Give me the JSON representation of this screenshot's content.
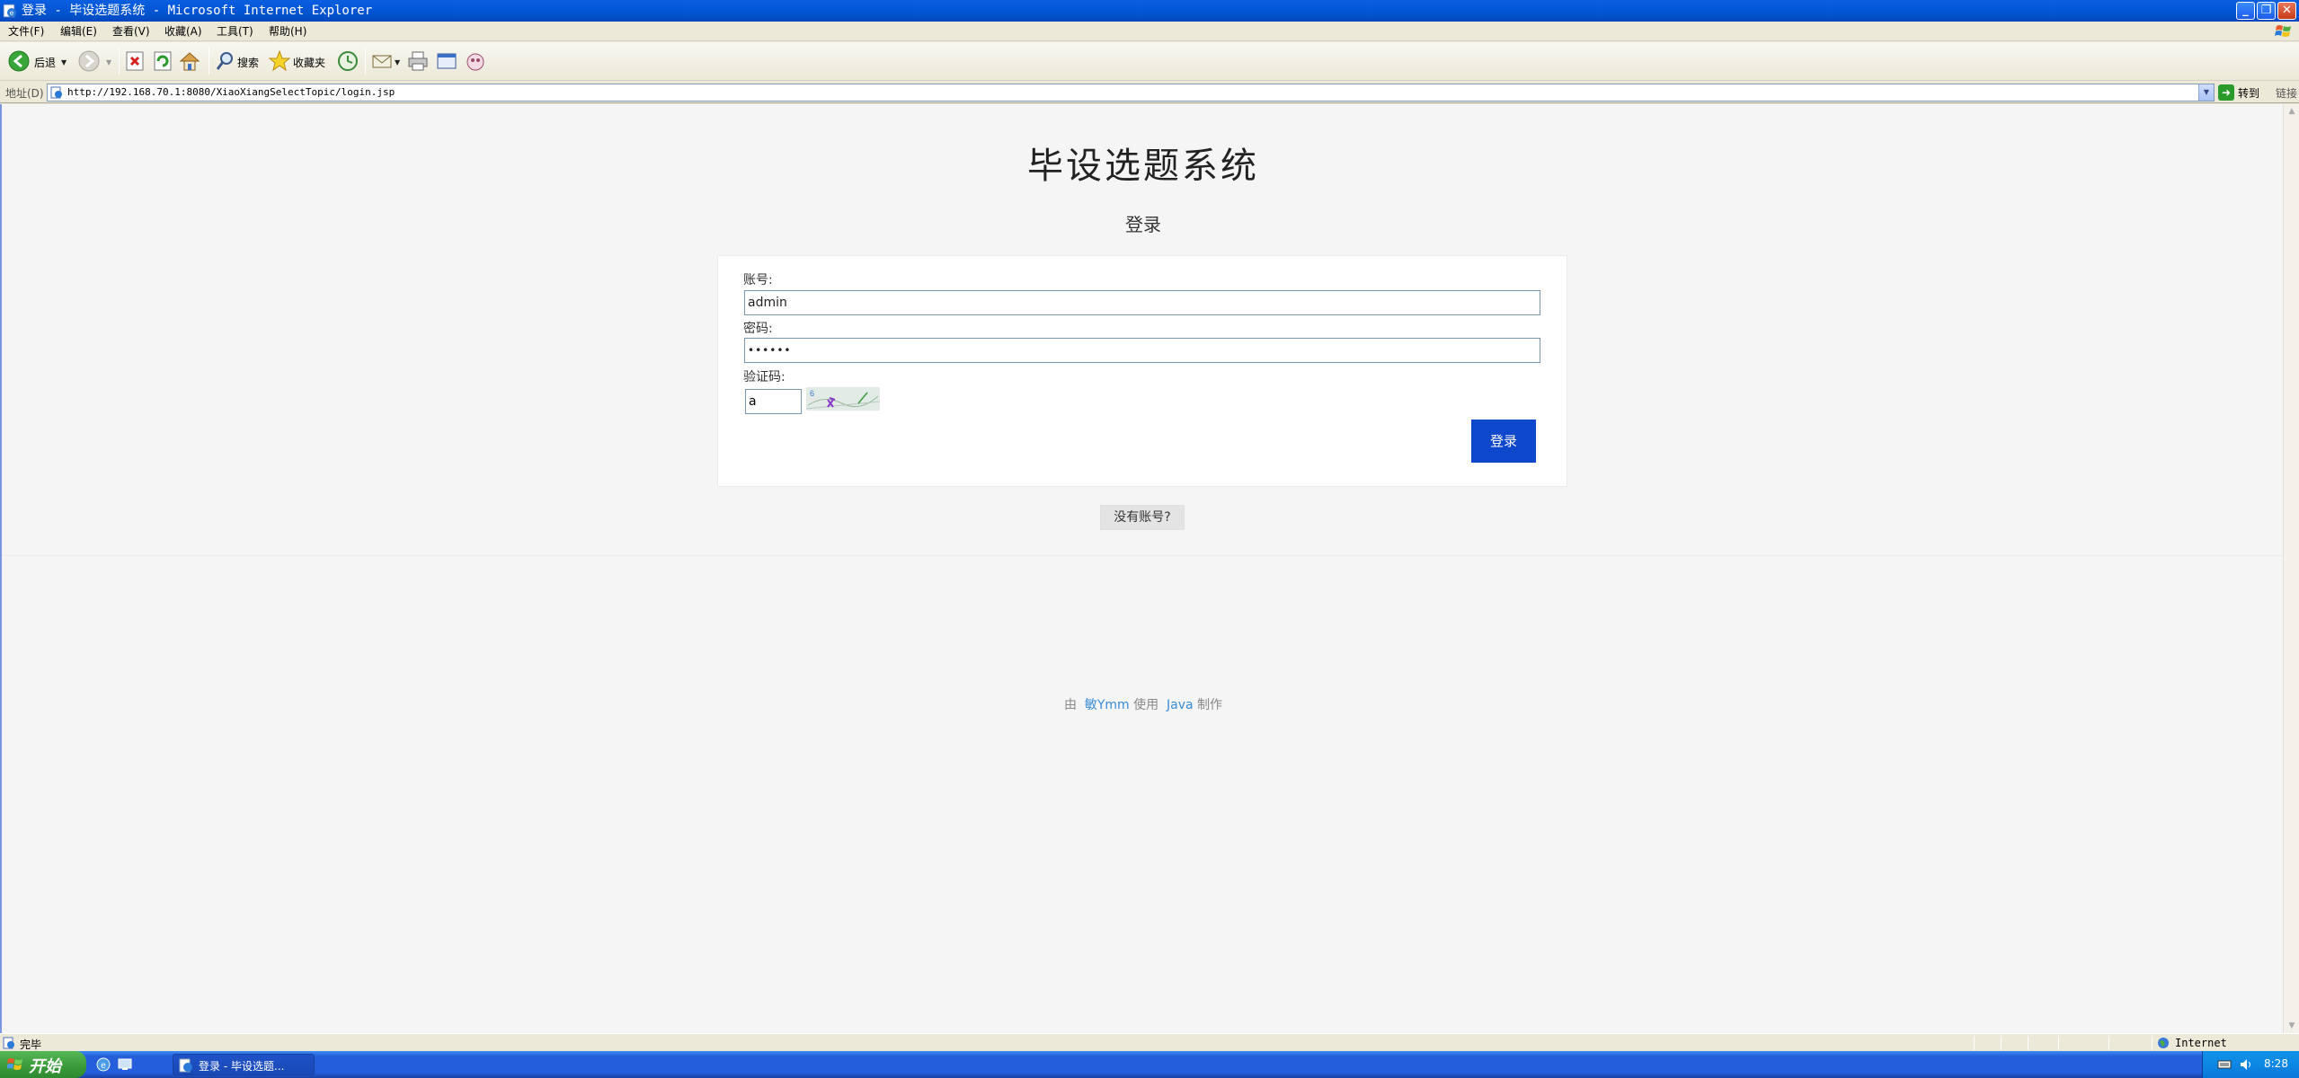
{
  "window": {
    "title": "登录 - 毕设选题系统 - Microsoft Internet Explorer"
  },
  "menu": {
    "items": [
      "文件(F)",
      "编辑(E)",
      "查看(V)",
      "收藏(A)",
      "工具(T)",
      "帮助(H)"
    ]
  },
  "toolbar": {
    "back_label": "后退",
    "search_label": "搜索",
    "favorites_label": "收藏夹"
  },
  "address": {
    "label": "地址(D)",
    "url": "http://192.168.70.1:8080/XiaoXiangSelectTopic/login.jsp",
    "go_label": "转到",
    "links_label": "链接"
  },
  "page": {
    "title": "毕设选题系统",
    "subtitle": "登录",
    "form": {
      "account_label": "账号:",
      "account_value": "admin",
      "password_label": "密码:",
      "password_value": "••••••",
      "captcha_label": "验证码:",
      "captcha_value": "a",
      "login_label": "登录"
    },
    "register_label": "没有账号?",
    "footer": {
      "prefix": "由",
      "author": "敏Ymm",
      "middle": "使用",
      "tech": "Java",
      "suffix": "制作"
    }
  },
  "status": {
    "text": "完毕",
    "zone": "Internet"
  },
  "taskbar": {
    "start_label": "开始",
    "task_label": "登录 - 毕设选题...",
    "clock": "8:28"
  },
  "colors": {
    "title_bar": "#0458d8",
    "login_button": "#0c47cc",
    "link": "#3a8bd8",
    "page_background": "#f5f5f5"
  }
}
